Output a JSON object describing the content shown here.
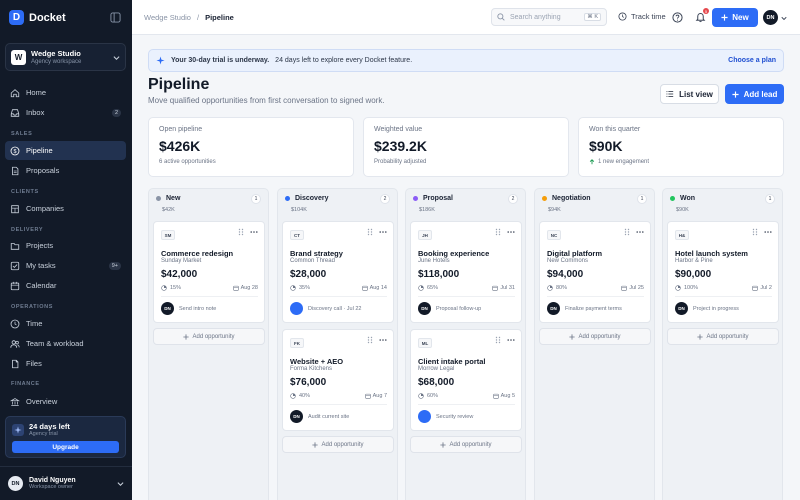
{
  "brand": {
    "name": "Docket",
    "logo_letter": "D"
  },
  "workspace": {
    "logo_letter": "W",
    "name": "Wedge Studio",
    "subtitle": "Agency workspace"
  },
  "nav": {
    "home": "Home",
    "inbox": "Inbox",
    "inbox_badge": "2",
    "section_sales": "SALES",
    "pipeline": "Pipeline",
    "proposals": "Proposals",
    "section_clients": "CLIENTS",
    "companies": "Companies",
    "section_delivery": "DELIVERY",
    "projects": "Projects",
    "my_tasks": "My tasks",
    "my_tasks_badge": "9+",
    "calendar": "Calendar",
    "section_operations": "OPERATIONS",
    "time": "Time",
    "team": "Team & workload",
    "files": "Files",
    "section_finance": "FINANCE",
    "overview": "Overview"
  },
  "trial_card": {
    "title": "24 days left",
    "subtitle": "Agency trial",
    "button": "Upgrade"
  },
  "user": {
    "initials": "DN",
    "name": "David Nguyen",
    "role": "Workspace owner"
  },
  "topbar": {
    "crumb_root": "Wedge Studio",
    "crumb_sep": "/",
    "crumb_current": "Pipeline",
    "search_placeholder": "Search anything",
    "search_kbd": "⌘ K",
    "track_time": "Track time",
    "notif_count": "5",
    "new_button": "New",
    "avatar": "DN"
  },
  "banner": {
    "bold": "Your 30-day trial is underway.",
    "text": "24 days left to explore every Docket feature.",
    "link": "Choose a plan"
  },
  "page": {
    "title": "Pipeline",
    "subtitle": "Move qualified opportunities from first conversation to signed work.",
    "list_view": "List view",
    "add_lead": "Add lead"
  },
  "stats": [
    {
      "label": "Open pipeline",
      "value": "$426K",
      "note": "6 active opportunities"
    },
    {
      "label": "Weighted value",
      "value": "$239.2K",
      "note": "Probability adjusted"
    },
    {
      "label": "Won this quarter",
      "value": "$90K",
      "note": "1 new engagement"
    }
  ],
  "add_opportunity": "Add opportunity",
  "columns": [
    {
      "name": "New",
      "count": "1",
      "total": "$42K",
      "color": "#8a94a6",
      "cards": [
        {
          "tag": "SM",
          "title": "Commerce redesign",
          "client": "Sunday Market",
          "value": "$42,000",
          "prob": "15%",
          "date": "Aug 28",
          "owner": "DN",
          "owner_style": "dark",
          "task": "Send intro note"
        }
      ]
    },
    {
      "name": "Discovery",
      "count": "2",
      "total": "$104K",
      "color": "#2d6cf6",
      "cards": [
        {
          "tag": "CT",
          "title": "Brand strategy",
          "client": "Common Thread",
          "value": "$28,000",
          "prob": "35%",
          "date": "Aug 14",
          "owner": "",
          "owner_style": "blue",
          "task": "Discovery call · Jul 22"
        },
        {
          "tag": "FK",
          "title": "Website + AEO",
          "client": "Forma Kitchens",
          "value": "$76,000",
          "prob": "40%",
          "date": "Aug 7",
          "owner": "DN",
          "owner_style": "dark",
          "task": "Audit current site"
        }
      ]
    },
    {
      "name": "Proposal",
      "count": "2",
      "total": "$186K",
      "color": "#8b5cf6",
      "cards": [
        {
          "tag": "JH",
          "title": "Booking experience",
          "client": "June Hotels",
          "value": "$118,000",
          "prob": "65%",
          "date": "Jul 31",
          "owner": "DN",
          "owner_style": "dark",
          "task": "Proposal follow-up"
        },
        {
          "tag": "ML",
          "title": "Client intake portal",
          "client": "Morrow Legal",
          "value": "$68,000",
          "prob": "60%",
          "date": "Aug 5",
          "owner": "",
          "owner_style": "blue",
          "task": "Security review"
        }
      ]
    },
    {
      "name": "Negotiation",
      "count": "1",
      "total": "$94K",
      "color": "#f59e0b",
      "cards": [
        {
          "tag": "NC",
          "title": "Digital platform",
          "client": "New Commons",
          "value": "$94,000",
          "prob": "80%",
          "date": "Jul 25",
          "owner": "DN",
          "owner_style": "dark",
          "task": "Finalize payment terms"
        }
      ]
    },
    {
      "name": "Won",
      "count": "1",
      "total": "$90K",
      "color": "#22c55e",
      "cards": [
        {
          "tag": "H&",
          "title": "Hotel launch system",
          "client": "Harbor & Pine",
          "value": "$90,000",
          "prob": "100%",
          "date": "Jul 2",
          "owner": "DN",
          "owner_style": "dark",
          "task": "Project in progress"
        }
      ]
    }
  ]
}
